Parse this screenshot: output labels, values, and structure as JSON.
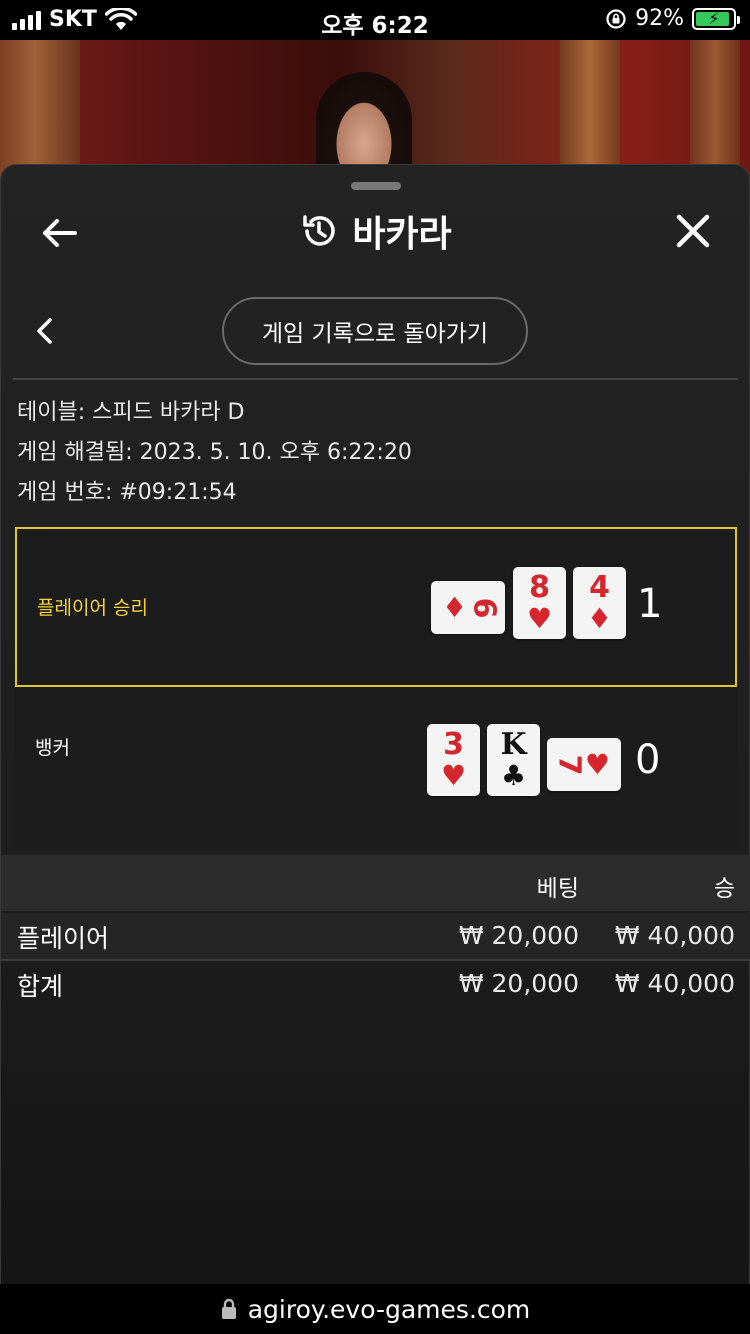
{
  "status_bar": {
    "carrier": "SKT",
    "time": "오후 6:22",
    "battery": "92%"
  },
  "header": {
    "title": "바카라"
  },
  "sub_nav": {
    "back_to_history": "게임 기록으로 돌아가기"
  },
  "game_info": {
    "table": "테이블: 스피드 바카라 D",
    "resolved": "게임 해결됨: 2023. 5. 10. 오후 6:22:20",
    "game_number": "게임 번호: #09:21:54"
  },
  "results": {
    "player": {
      "label": "플레이어 승리",
      "score": "1",
      "cards": [
        {
          "rank": "6",
          "suit": "♦",
          "color": "red",
          "orientation": "side"
        },
        {
          "rank": "8",
          "suit": "♥",
          "color": "red",
          "orientation": "upright"
        },
        {
          "rank": "4",
          "suit": "♦",
          "color": "red",
          "orientation": "upright"
        }
      ]
    },
    "banker": {
      "label": "뱅커",
      "score": "0",
      "cards": [
        {
          "rank": "3",
          "suit": "♥",
          "color": "red",
          "orientation": "upright"
        },
        {
          "rank": "K",
          "suit": "♣",
          "color": "black",
          "orientation": "upright"
        },
        {
          "rank": "7",
          "suit": "♥",
          "color": "red",
          "orientation": "side"
        }
      ]
    }
  },
  "bets_table": {
    "headers": {
      "bet": "베팅",
      "win": "승"
    },
    "rows": [
      {
        "name": "플레이어",
        "bet": "₩ 20,000",
        "win": "₩ 40,000"
      },
      {
        "name": "합계",
        "bet": "₩ 20,000",
        "win": "₩ 40,000"
      }
    ]
  },
  "url_bar": {
    "url": "agiroy.evo-games.com"
  },
  "colors": {
    "accent_yellow": "#e3c62b",
    "card_red": "#d6262d",
    "battery_green": "#35c759"
  }
}
